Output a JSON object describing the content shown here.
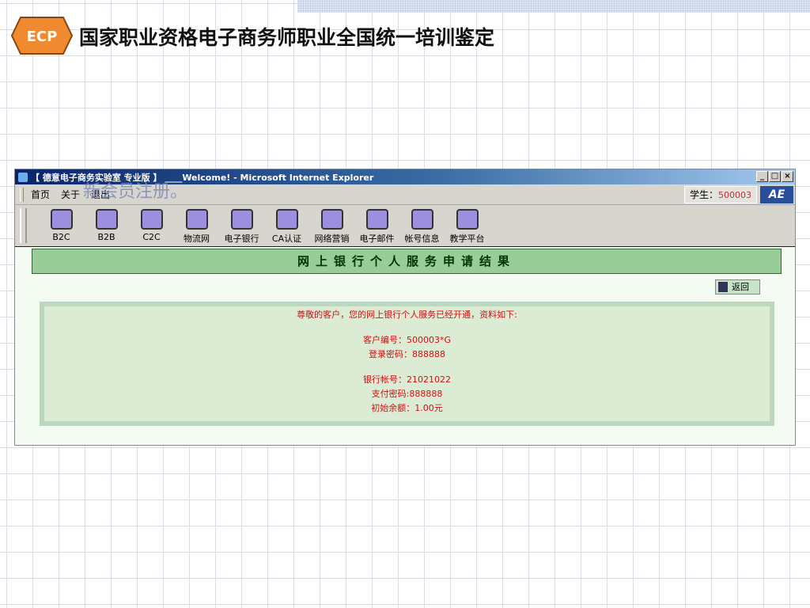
{
  "slide": {
    "title": "国家职业资格电子商务师职业全国统一培训鉴定",
    "logo_text": "ECP",
    "overlay_text": "新会员注册。"
  },
  "window": {
    "title": "【 德意电子商务实验室 专业版 】 ____Welcome! - Microsoft Internet Explorer",
    "controls": [
      "_",
      "□",
      "×"
    ]
  },
  "menu": {
    "items": [
      "首页",
      "关于",
      "退出"
    ],
    "student_label": "学生：",
    "student_id": "500003",
    "brand": "AE"
  },
  "toolbar": [
    {
      "label": "B2C",
      "icon": "cart-icon"
    },
    {
      "label": "B2B",
      "icon": "network-icon"
    },
    {
      "label": "C2C",
      "icon": "folder-icon"
    },
    {
      "label": "物流网",
      "icon": "truck-icon"
    },
    {
      "label": "电子银行",
      "icon": "money-bag-icon"
    },
    {
      "label": "CA认证",
      "icon": "certificate-icon"
    },
    {
      "label": "网络营销",
      "icon": "org-chart-icon"
    },
    {
      "label": "电子邮件",
      "icon": "mail-icon"
    },
    {
      "label": "帐号信息",
      "icon": "help-book-icon"
    },
    {
      "label": "教学平台",
      "icon": "pen-scroll-icon"
    }
  ],
  "content": {
    "heading": "网上银行个人服务申请结果",
    "return_label": "返回",
    "intro": "尊敬的客户，您的网上银行个人服务已经开通，资料如下:",
    "lines1": [
      "客户编号：500003*G",
      "登录密码：888888"
    ],
    "lines2": [
      "银行帐号：21021022",
      "支付密码:888888",
      "初始余额：1.00元"
    ]
  },
  "colors": {
    "header": "#99cc99",
    "text_red": "#cc1111"
  }
}
